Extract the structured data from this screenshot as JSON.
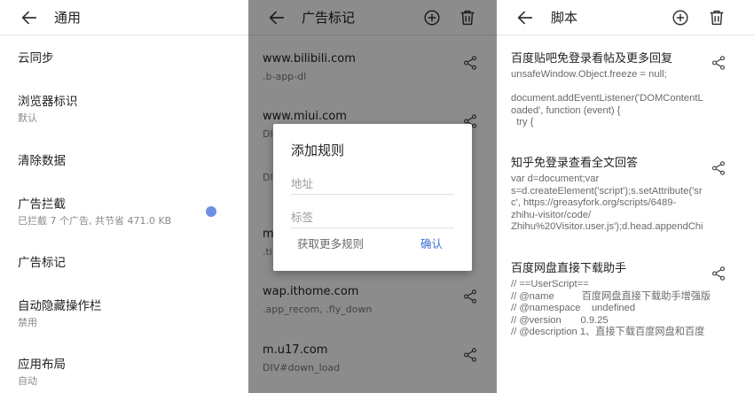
{
  "general": {
    "title": "通用",
    "items": [
      {
        "title": "云同步",
        "subtitle": ""
      },
      {
        "title": "浏览器标识",
        "subtitle": "默认"
      },
      {
        "title": "清除数据",
        "subtitle": ""
      },
      {
        "title": "广告拦截",
        "subtitle": "已拦截 7 个广告, 共节省 471.0 KB"
      },
      {
        "title": "广告标记",
        "subtitle": ""
      },
      {
        "title": "自动隐藏操作栏",
        "subtitle": "禁用"
      },
      {
        "title": "应用布局",
        "subtitle": "自动"
      }
    ]
  },
  "ad_marks": {
    "title": "广告标记",
    "items": [
      {
        "domain": "www.bilibili.com",
        "rule": ".b-app-dl"
      },
      {
        "domain": "www.miui.com",
        "rule": "DIV"
      },
      {
        "domain": "",
        "rule": "DIV"
      },
      {
        "domain": "m",
        "rule": ".ti"
      },
      {
        "domain": "wap.ithome.com",
        "rule": ".app_recom, .fly_down"
      },
      {
        "domain": "m.u17.com",
        "rule": "DIV#down_load"
      }
    ],
    "dialog": {
      "title": "添加规则",
      "address_placeholder": "地址",
      "tag_placeholder": "标签",
      "more_rules": "获取更多规则",
      "confirm": "确认"
    }
  },
  "scripts": {
    "title": "脚本",
    "items": [
      {
        "name": "百度贴吧免登录看帖及更多回复",
        "code": "unsafeWindow.Object.freeze = null;\n\ndocument.addEventListener('DOMContentL\noaded', function (event) {\n  try {"
      },
      {
        "name": "知乎免登录查看全文回答",
        "code": "var d=document;var\ns=d.createElement('script');s.setAttribute('sr\nc', https://greasyfork.org/scripts/6489-\nzhihu-visitor/code/\nZhihu%20Visitor.user.js');d.head.appendChi"
      },
      {
        "name": "百度网盘直接下载助手",
        "code": "// ==UserScript==\n// @name          百度网盘直接下载助手增强版\n// @namespace    undefined\n// @version       0.9.25\n// @description 1、直接下载百度网盘和百度"
      }
    ]
  },
  "icons": {
    "back": "arrow-left-icon",
    "add": "plus-circle-icon",
    "delete": "trash-icon",
    "share": "share-icon"
  },
  "colors": {
    "toggle_dot": "#6f8fe6",
    "confirm": "#3b6fd3"
  }
}
